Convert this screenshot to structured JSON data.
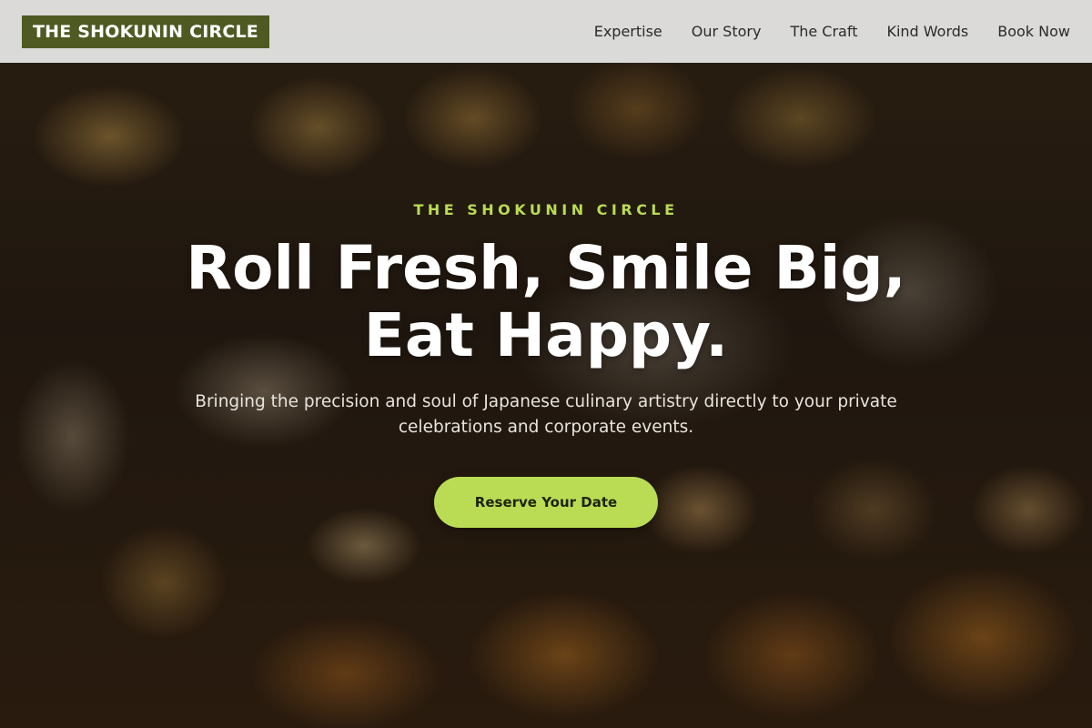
{
  "header": {
    "logo": "THE SHOKUNIN CIRCLE",
    "nav": [
      {
        "label": "Expertise"
      },
      {
        "label": "Our Story"
      },
      {
        "label": "The Craft"
      },
      {
        "label": "Kind Words"
      },
      {
        "label": "Book Now"
      }
    ]
  },
  "hero": {
    "eyebrow": "THE SHOKUNIN CIRCLE",
    "headline_line1": "Roll Fresh, Smile Big,",
    "headline_line2": "Eat Happy.",
    "subtext": "Bringing the precision and soul of Japanese culinary artistry directly to your private celebrations and corporate events.",
    "cta_label": "Reserve Your Date"
  },
  "colors": {
    "accent": "#b9dc54",
    "logo_bg": "#4e5a22",
    "header_bg": "#e8e8e8"
  }
}
